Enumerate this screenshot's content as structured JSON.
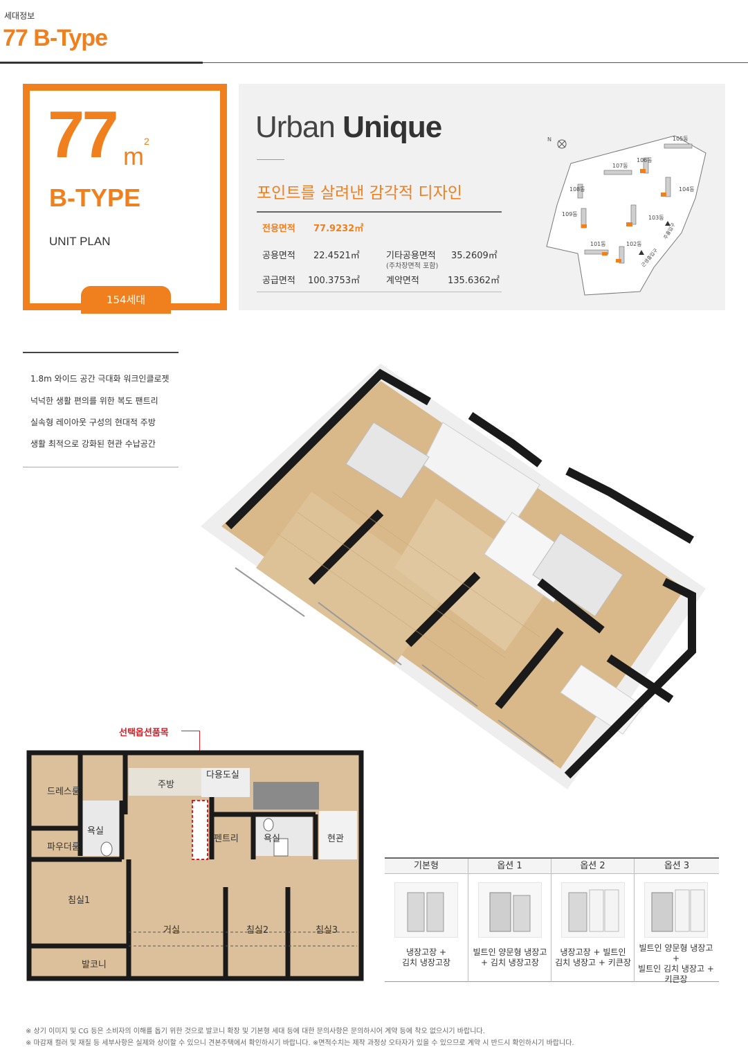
{
  "header": {
    "label": "세대정보",
    "title": "77 B-Type"
  },
  "type_box": {
    "size_number": "77",
    "size_unit": "m",
    "size_unit_sup": "2",
    "type_name": "B-TYPE",
    "plan_label": "UNIT PLAN",
    "households": "154세대"
  },
  "info": {
    "brand_light": "Urban ",
    "brand_bold": "Unique",
    "slogan": "포인트를 살려낸 감각적 디자인",
    "exclusive_label": "전용면적",
    "exclusive_value": "77.9232㎡",
    "common_label": "공용면적",
    "common_value": "22.4521㎡",
    "other_common_label": "기타공용면적",
    "other_common_note": "(주차장면적 포함)",
    "other_common_value": "35.2609㎡",
    "supply_label": "공급면적",
    "supply_value": "100.3753㎡",
    "contract_label": "계약면적",
    "contract_value": "135.6362㎡"
  },
  "site_map": {
    "north": "N",
    "buildings": [
      "105동",
      "106동",
      "107동",
      "104동",
      "108동",
      "103동",
      "109동",
      "101동",
      "102동"
    ],
    "entrance_main": "주출입구",
    "entrance_sub": "근생출입구"
  },
  "features": [
    "1.8m 와이드 공간 극대화 워크인클로젯",
    "넉넉한 생활 편의를 위한 복도 팬트리",
    "실속형 레이아웃 구성의 현대적 주방",
    "생활 최적으로 강화된 현관 수납공간"
  ],
  "floor_plan": {
    "option_label": "선택옵션품목",
    "rooms": {
      "dressroom": "드레스룸",
      "kitchen": "주방",
      "utility": "다용도실",
      "bath1": "욕실",
      "powder": "파우더룸",
      "pantry": "펜트리",
      "bath2": "욕실",
      "entrance": "현관",
      "bedroom1": "침실1",
      "living": "거실",
      "bedroom2": "침실2",
      "bedroom3": "침실3",
      "balcony": "발코니"
    }
  },
  "options": [
    {
      "head": "기본형",
      "caption": [
        "냉장고장 +",
        "김치 냉장고장"
      ]
    },
    {
      "head": "옵션 1",
      "caption": [
        "빌트인 양문형 냉장고",
        "+ 김치 냉장고장"
      ]
    },
    {
      "head": "옵션 2",
      "caption": [
        "냉장고장 + 빌트인",
        "김치 냉장고 + 키큰장"
      ]
    },
    {
      "head": "옵션 3",
      "caption": [
        "빌트인 양문형 냉장고 +",
        "빌트인 김치 냉장고 +",
        "키큰장"
      ]
    }
  ],
  "notes": [
    "※ 상기 이미지 및 CG 등은 소비자의 이해를 돕기 위한 것으로 발코니 확장 및 기본형 세대 등에 대한 문의사항은 문의하시어 계약 등에 착오 없으시기 바랍니다.",
    "※ 마감재 컬러 및 재질 등 세부사항은 실제와 상이할 수 있으니 견본주택에서 확인하시기 바랍니다. ※면적수치는 제작 과정상 오타자가 있을 수 있으므로 계약 시 반드시 확인하시기 바랍니다."
  ],
  "colors": {
    "accent": "#f07f1e",
    "option_red": "#e01b24",
    "panel_bg": "#f1f1f1",
    "wall": "#1a1a1a",
    "floor_wood": "#d9b98a"
  }
}
